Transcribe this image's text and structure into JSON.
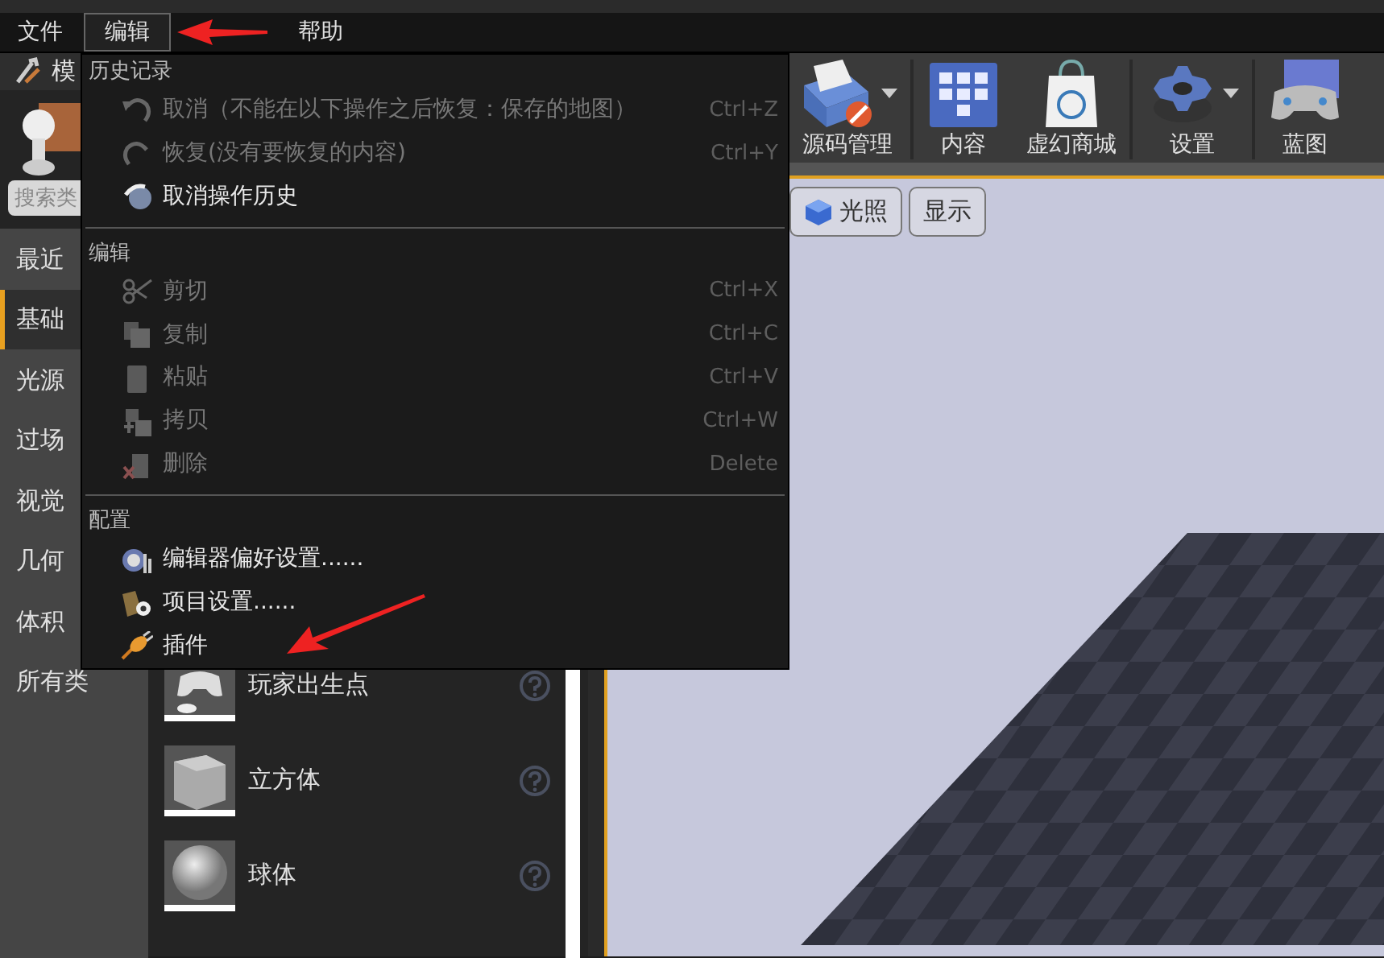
{
  "menu_bar": [
    {
      "label": "文件",
      "selected": false
    },
    {
      "label": "编辑",
      "selected": true
    },
    {
      "label": "帮助",
      "selected": false
    }
  ],
  "modes_panel": {
    "tab": "模",
    "search": {
      "placeholder": "搜索类"
    },
    "categories": [
      {
        "label": "最近",
        "selected": false
      },
      {
        "label": "基础",
        "selected": true
      },
      {
        "label": "光源",
        "selected": false
      },
      {
        "label": "过场",
        "selected": false
      },
      {
        "label": "视觉",
        "selected": false
      },
      {
        "label": "几何",
        "selected": false
      },
      {
        "label": "体积",
        "selected": false
      },
      {
        "label": "所有类",
        "selected": false
      }
    ],
    "items": [
      {
        "label": "玩家出生点"
      },
      {
        "label": "立方体"
      },
      {
        "label": "球体"
      }
    ]
  },
  "toolbar": [
    {
      "label": "源码管理",
      "dropdown": true
    },
    {
      "label": "内容",
      "dropdown": false
    },
    {
      "label": "虚幻商城",
      "dropdown": false
    },
    {
      "label": "设置",
      "dropdown": true
    },
    {
      "label": "蓝图",
      "dropdown": false
    }
  ],
  "viewport": {
    "buttons": [
      "光照",
      "显示"
    ]
  },
  "edit_menu": {
    "sections": [
      {
        "header": "历史记录",
        "items": [
          {
            "label": "取消（不能在以下操作之后恢复：保存的地图）",
            "shortcut": "Ctrl+Z",
            "disabled": true
          },
          {
            "label": "恢复(没有要恢复的内容)",
            "shortcut": "Ctrl+Y",
            "disabled": true
          },
          {
            "label": "取消操作历史",
            "disabled": false
          }
        ]
      },
      {
        "header": "编辑",
        "items": [
          {
            "label": "剪切",
            "shortcut": "Ctrl+X",
            "disabled": true
          },
          {
            "label": "复制",
            "shortcut": "Ctrl+C",
            "disabled": true
          },
          {
            "label": "粘贴",
            "shortcut": "Ctrl+V",
            "disabled": true
          },
          {
            "label": "拷贝",
            "shortcut": "Ctrl+W",
            "disabled": true
          },
          {
            "label": "删除",
            "shortcut": "Delete",
            "disabled": true
          }
        ]
      },
      {
        "header": "配置",
        "items": [
          {
            "label": "编辑器偏好设置......",
            "disabled": false
          },
          {
            "label": "项目设置......",
            "disabled": false
          },
          {
            "label": "插件",
            "disabled": false
          }
        ]
      }
    ]
  }
}
